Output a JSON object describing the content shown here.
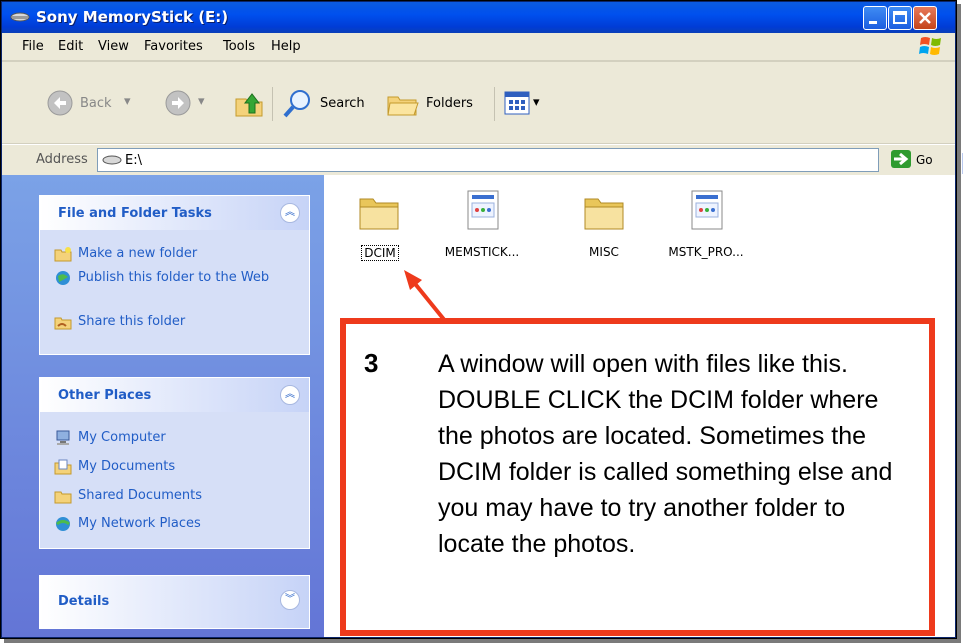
{
  "window": {
    "title": "Sony MemoryStick (E:)"
  },
  "menu": {
    "items": [
      "File",
      "Edit",
      "View",
      "Favorites",
      "Tools",
      "Help"
    ]
  },
  "toolbar": {
    "back_label": "Back",
    "search_label": "Search",
    "folders_label": "Folders"
  },
  "address": {
    "label": "Address",
    "value": "E:\\",
    "go_label": "Go"
  },
  "left_pane": {
    "file_tasks": {
      "title": "File and Folder Tasks",
      "items": [
        {
          "label": "Make a new folder",
          "icon": "new-folder-icon"
        },
        {
          "label": "Publish this folder to the Web",
          "icon": "publish-web-icon"
        },
        {
          "label": "Share this folder",
          "icon": "share-folder-icon"
        }
      ]
    },
    "other_places": {
      "title": "Other Places",
      "items": [
        {
          "label": "My Computer",
          "icon": "my-computer-icon"
        },
        {
          "label": "My Documents",
          "icon": "my-documents-icon"
        },
        {
          "label": "Shared Documents",
          "icon": "shared-documents-icon"
        },
        {
          "label": "My Network Places",
          "icon": "network-places-icon"
        }
      ]
    },
    "details": {
      "title": "Details"
    }
  },
  "files": [
    {
      "name": "DCIM",
      "type": "folder"
    },
    {
      "name": "MEMSTICK...",
      "type": "file"
    },
    {
      "name": "MISC",
      "type": "folder"
    },
    {
      "name": "MSTK_PRO...",
      "type": "file"
    }
  ],
  "callout": {
    "number": "3",
    "text": "A window will open with files like this.  DOUBLE CLICK the DCIM folder where the photos are located.  Sometimes the DCIM folder is called something else and you may have to try another folder to locate the photos."
  },
  "colors": {
    "title_bar": "#0050ee",
    "callout_border": "#ee3a1c",
    "task_text": "#215dc6",
    "task_pane": "#7ba2e7"
  }
}
